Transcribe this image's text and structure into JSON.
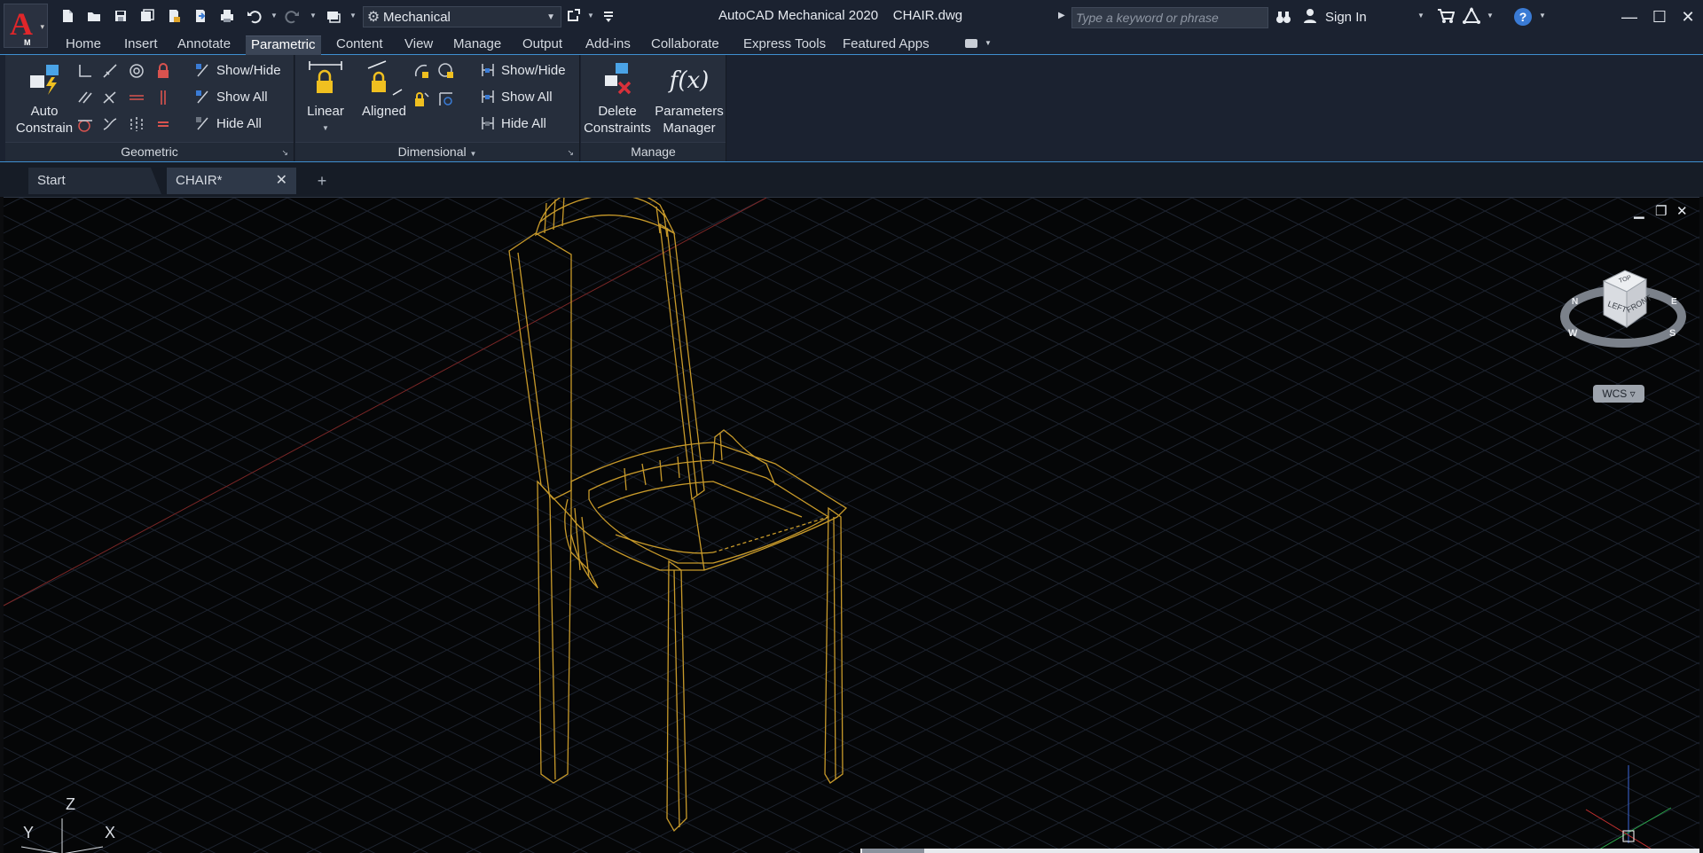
{
  "titlebar": {
    "app_name": "AutoCAD Mechanical 2020",
    "file_name": "CHAIR.dwg",
    "app_badge": "M",
    "workspace": "Mechanical",
    "search_placeholder": "Type a keyword or phrase",
    "sign_in": "Sign In"
  },
  "ribbon_tabs": [
    "Home",
    "Insert",
    "Annotate",
    "Parametric",
    "Content",
    "View",
    "Manage",
    "Output",
    "Add-ins",
    "Collaborate",
    "Express Tools",
    "Featured Apps"
  ],
  "active_tab": "Parametric",
  "ribbon": {
    "geometric": {
      "title": "Geometric",
      "auto_constrain_line1": "Auto",
      "auto_constrain_line2": "Constrain",
      "show_hide": "Show/Hide",
      "show_all": "Show All",
      "hide_all": "Hide All"
    },
    "dimensional": {
      "title": "Dimensional",
      "linear": "Linear",
      "aligned": "Aligned",
      "show_hide": "Show/Hide",
      "show_all": "Show All",
      "hide_all": "Hide All"
    },
    "manage": {
      "title": "Manage",
      "delete_line1": "Delete",
      "delete_line2": "Constraints",
      "params_line1": "Parameters",
      "params_line2": "Manager",
      "params_glyph": "f(x)"
    }
  },
  "file_tabs": {
    "start": "Start",
    "chair": "CHAIR*",
    "add": "+"
  },
  "viewcube": {
    "top": "TOP",
    "left": "LEFT",
    "front": "FRONT",
    "n": "N",
    "w": "W",
    "s": "S",
    "e": "E",
    "wcs": "WCS"
  },
  "ucs": {
    "x": "X",
    "y": "Y",
    "z": "Z"
  },
  "colors": {
    "wireframe": "#c89a2a",
    "grid": "#1e2430",
    "accent": "#3f8fd0",
    "x_axis": "#8a2a2a"
  }
}
